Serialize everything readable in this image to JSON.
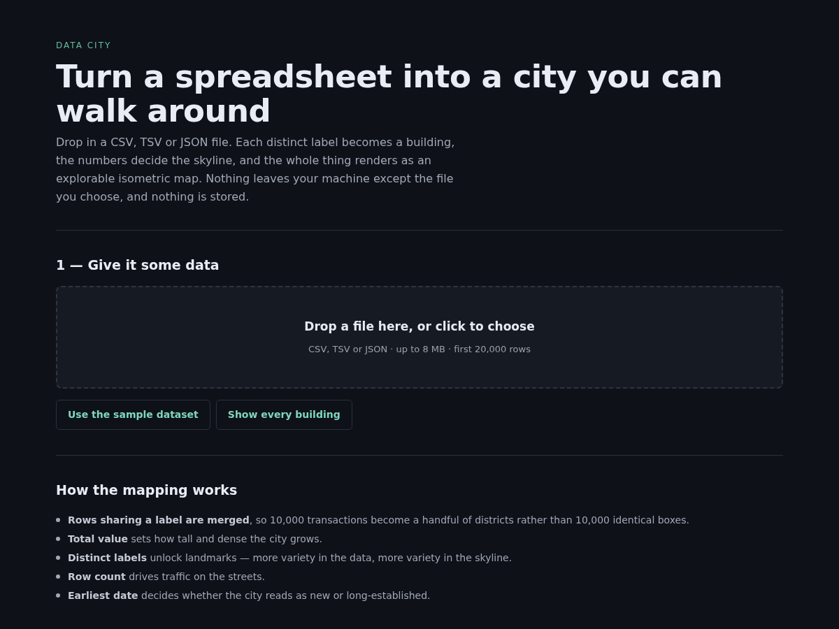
{
  "eyebrow": "DATA CITY",
  "title": "Turn a spreadsheet into a city you can walk around",
  "intro": "Drop in a CSV, TSV or JSON file. Each distinct label becomes a building, the numbers decide the skyline, and the whole thing renders as an explorable isometric map. Nothing leaves your machine except the file you choose, and nothing is stored.",
  "upload_section": {
    "heading": "1 — Give it some data",
    "dropzone": {
      "title": "Drop a file here, or click to choose",
      "hint": "CSV, TSV or JSON · up to 8 MB · first 20,000 rows"
    },
    "buttons": [
      "Use the sample dataset",
      "Show every building"
    ]
  },
  "mapping_section": {
    "heading": "How the mapping works",
    "items": [
      "**Rows sharing a label are merged**, so 10,000 transactions become a handful of districts rather than 10,000 identical boxes.",
      "**Total value** sets how tall and dense the city grows.",
      "**Distinct labels** unlock landmarks — more variety in the data, more variety in the skyline.",
      "**Row count** drives traffic on the streets.",
      "**Earliest date** decides whether the city reads as new or long-established."
    ]
  }
}
